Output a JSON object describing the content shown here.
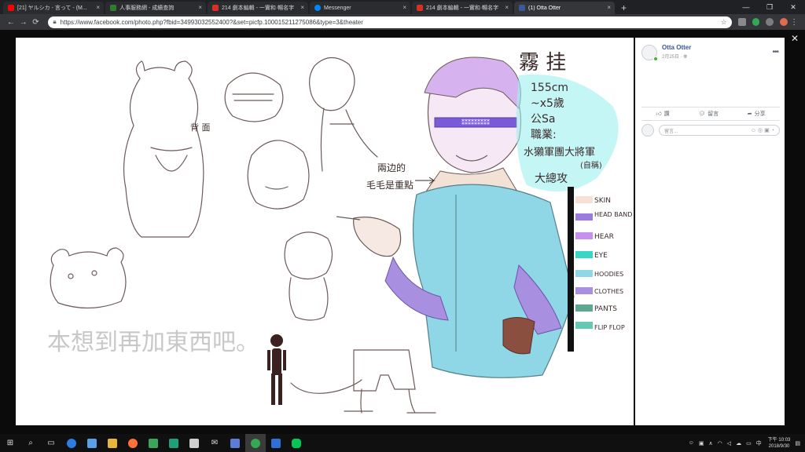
{
  "browser": {
    "tabs": [
      {
        "title": "[21] ヤルシカ - 言って - (M...",
        "favicon_color": "#ff0000"
      },
      {
        "title": "人事服務網 - 成績查詢",
        "favicon_color": "#2e7d32"
      },
      {
        "title": "214 劇本編輯 - 一實和·暢名字",
        "favicon_color": "#d93025"
      },
      {
        "title": "Messenger",
        "favicon_color": "#0084ff"
      },
      {
        "title": "214 劇本編輯 - 一實和·暢名字",
        "favicon_color": "#d93025"
      },
      {
        "title": "(1) Otta Otter",
        "favicon_color": "#3b5998"
      }
    ],
    "new_tab": "+",
    "url": "https://www.facebook.com/photo.php?fbid=34993032552400?&set=picfp.100015211275086&type=3&theater"
  },
  "post": {
    "author": "Otta Otter",
    "date": "2月25日 · ",
    "more": "•••",
    "actions": {
      "like": "讚",
      "comment": "留言",
      "share": "分享"
    },
    "comment_placeholder": "留言..."
  },
  "artwork": {
    "name_heading": "霧 挂",
    "stats": [
      "155cm",
      "~x5歲",
      "公Sa",
      "職業:",
      "水獺軍團大將軍",
      "(自稱)",
      "大總攻"
    ],
    "note": "兩边的 毛毛是重點",
    "back_label": "背 面",
    "bottom_caption": "本想到再加東西吧。",
    "palette": [
      {
        "label": "SKIN",
        "color": "#f5e2d4"
      },
      {
        "label": "HEAD BAND",
        "color": "#9b7be0"
      },
      {
        "label": "HEAR",
        "color": "#c78ff0"
      },
      {
        "label": "EYE",
        "color": "#39d6c8"
      },
      {
        "label": "HOODIES",
        "color": "#8fd6e6"
      },
      {
        "label": "CLOTHES",
        "color": "#a98fe0"
      },
      {
        "label": "PANTS",
        "color": "#5fa890"
      },
      {
        "label": "FLIP FLOP",
        "color": "#66c9b5"
      }
    ]
  },
  "taskbar": {
    "clock_time": "下午 10:03",
    "clock_date": "2018/9/30"
  }
}
